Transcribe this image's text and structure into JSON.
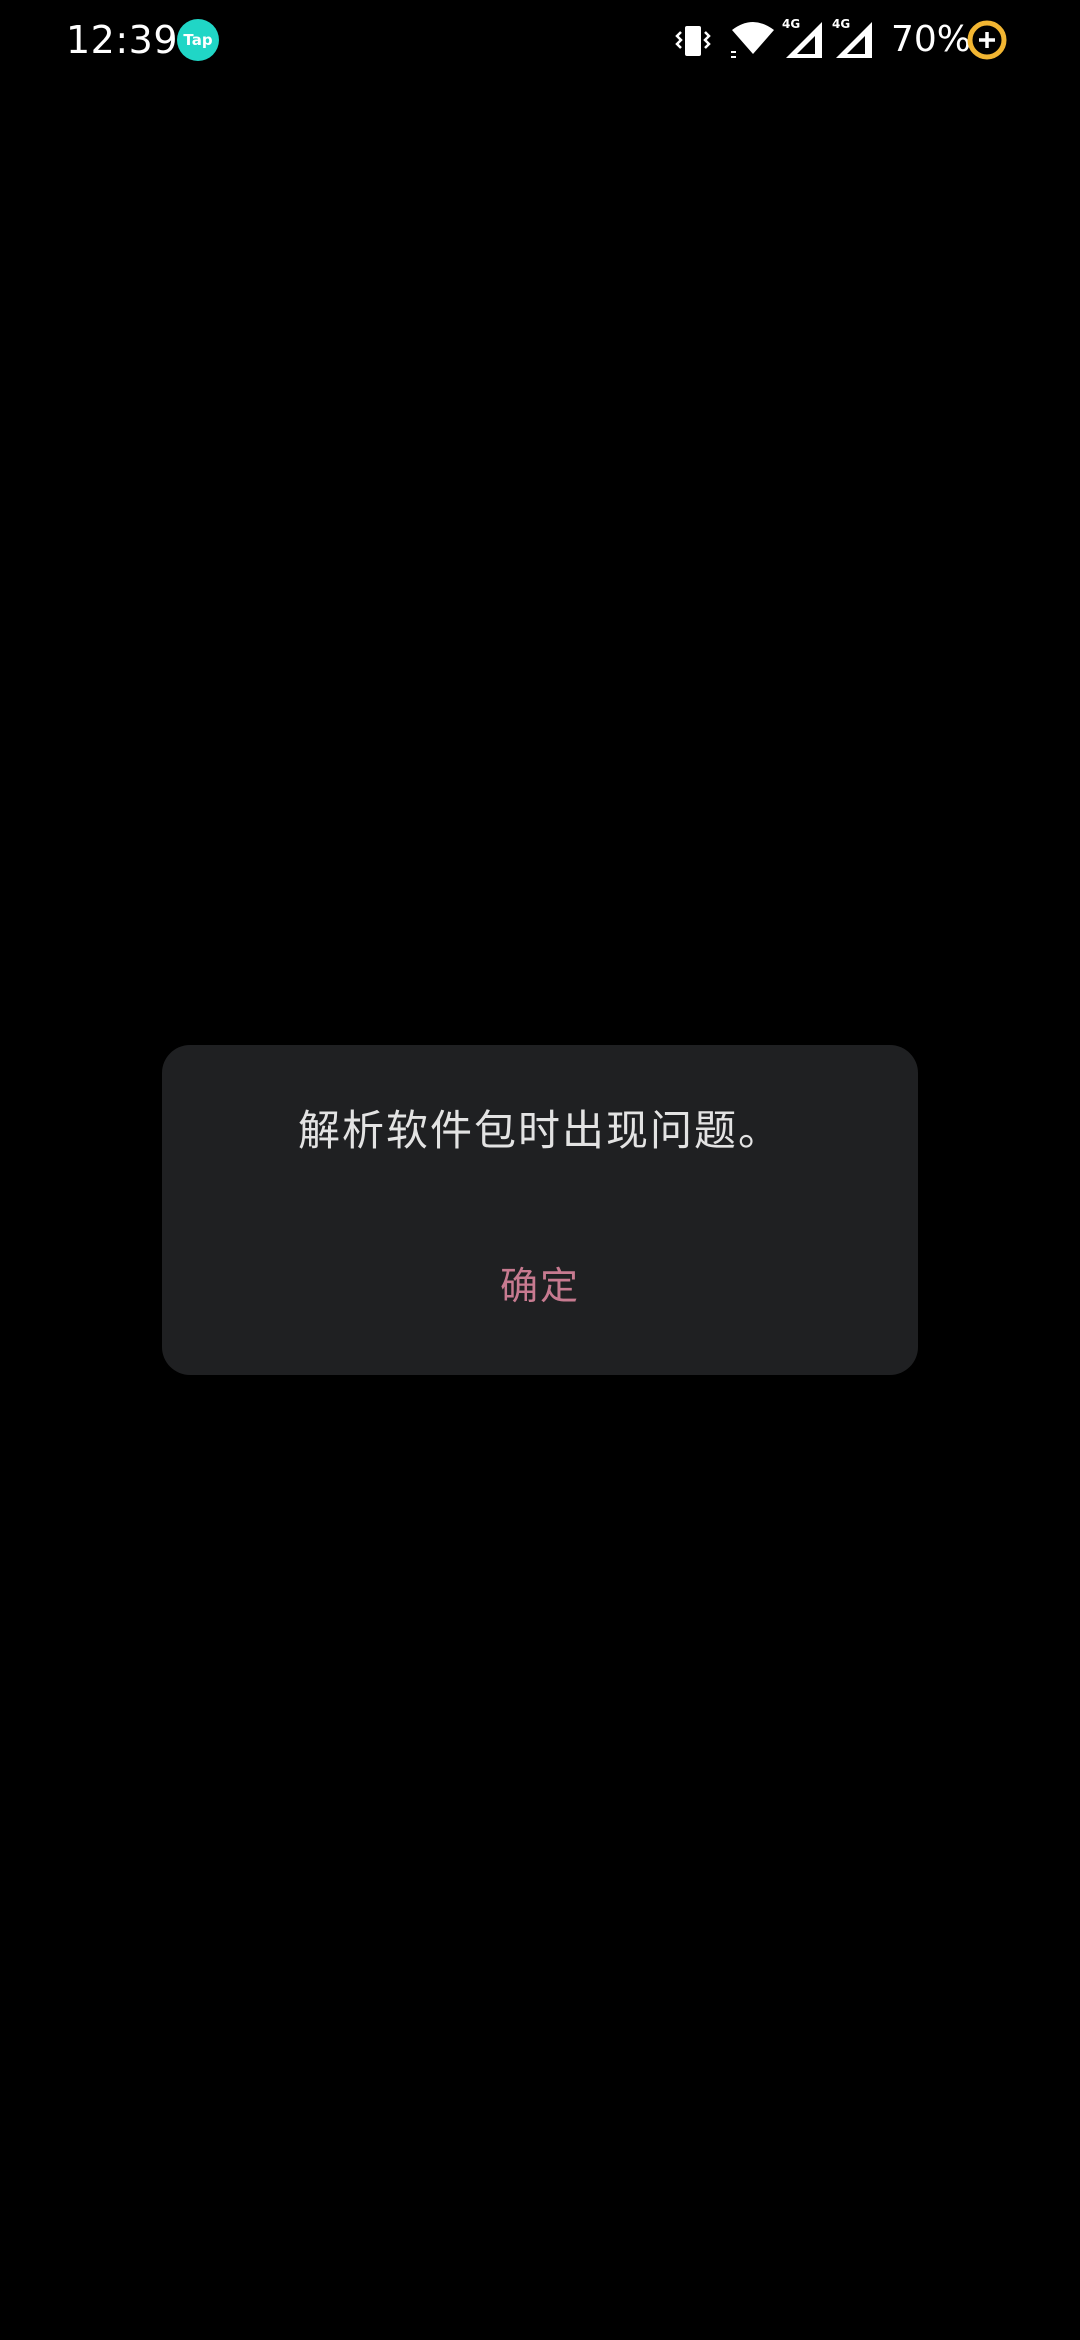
{
  "status_bar": {
    "time": "12:39",
    "notification_app_label": "Tap",
    "battery_percent": "70%",
    "signal_1_label": "4G",
    "signal_2_label": "4G",
    "icons": [
      "tap-app-icon",
      "vibrate-icon",
      "wifi-icon",
      "signal-4g-icon",
      "signal-4g-icon",
      "battery-saver-icon"
    ],
    "colors": {
      "tap_icon": "#20d6c6",
      "battery_ring": "#f2b632"
    }
  },
  "dialog": {
    "message": "解析软件包时出现问题。",
    "confirm_label": "确定",
    "colors": {
      "background": "#1f2022",
      "message": "#e3e3e3",
      "button": "#c77a90"
    }
  }
}
